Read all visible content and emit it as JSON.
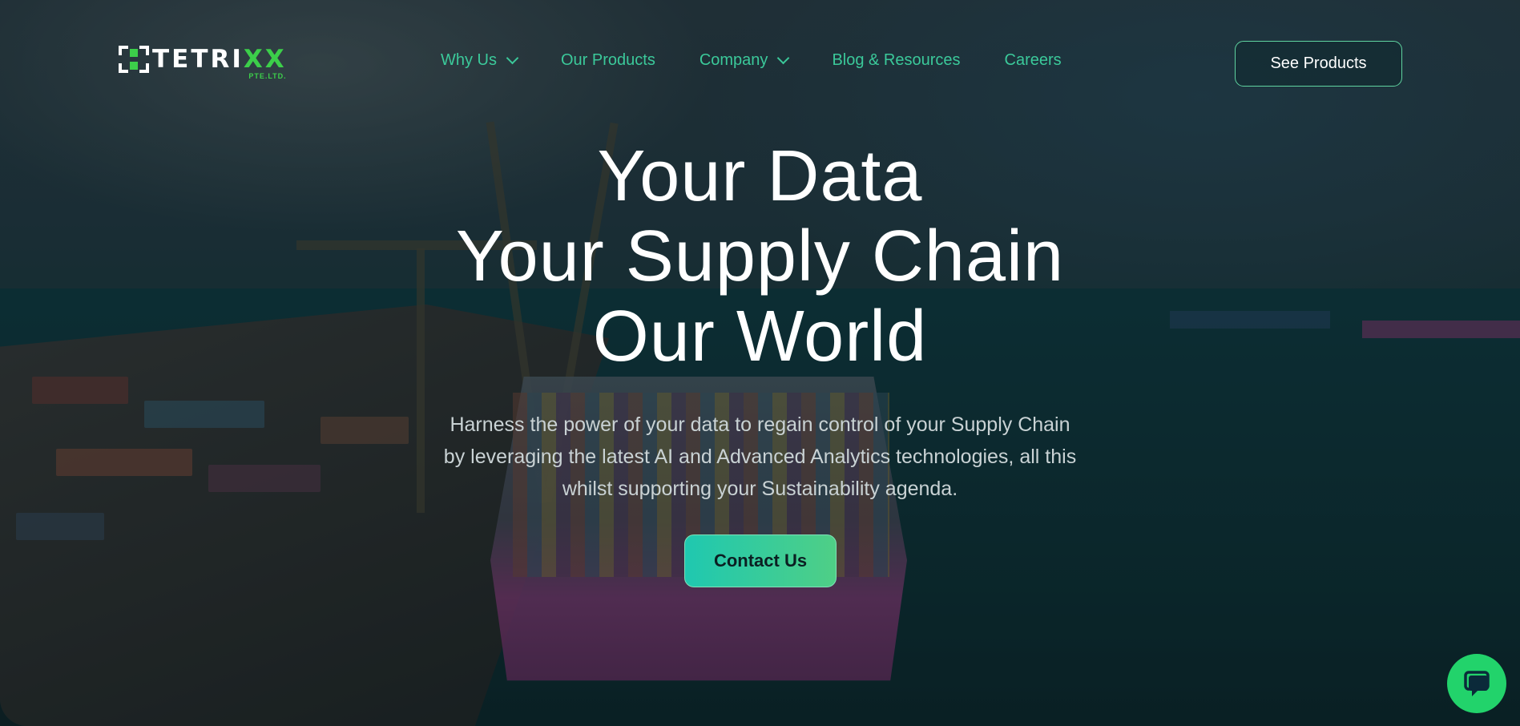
{
  "brand": {
    "name_main": "TETRI",
    "name_accent": "XX",
    "suffix": "PTE.LTD.",
    "accent_color": "#3ccf4a"
  },
  "nav": {
    "items": [
      {
        "label": "Why Us",
        "has_dropdown": true
      },
      {
        "label": "Our Products",
        "has_dropdown": false
      },
      {
        "label": "Company",
        "has_dropdown": true
      },
      {
        "label": "Blog & Resources",
        "has_dropdown": false
      },
      {
        "label": "Careers",
        "has_dropdown": false
      }
    ],
    "cta_label": "See Products",
    "link_color": "#3bc99a"
  },
  "hero": {
    "headline_lines": [
      "Your Data",
      "Your Supply Chain",
      "Our World"
    ],
    "subtext_lines": [
      "Harness the power of your data to regain control of your Supply Chain",
      "by leveraging the latest AI and Advanced Analytics technologies, all this",
      "whilst supporting your Sustainability agenda."
    ],
    "cta_label": "Contact Us",
    "cta_gradient": [
      "#1fc8b0",
      "#4fcf86"
    ]
  },
  "chat_widget": {
    "icon": "chat-bubble-icon",
    "color": "#22d36b"
  }
}
